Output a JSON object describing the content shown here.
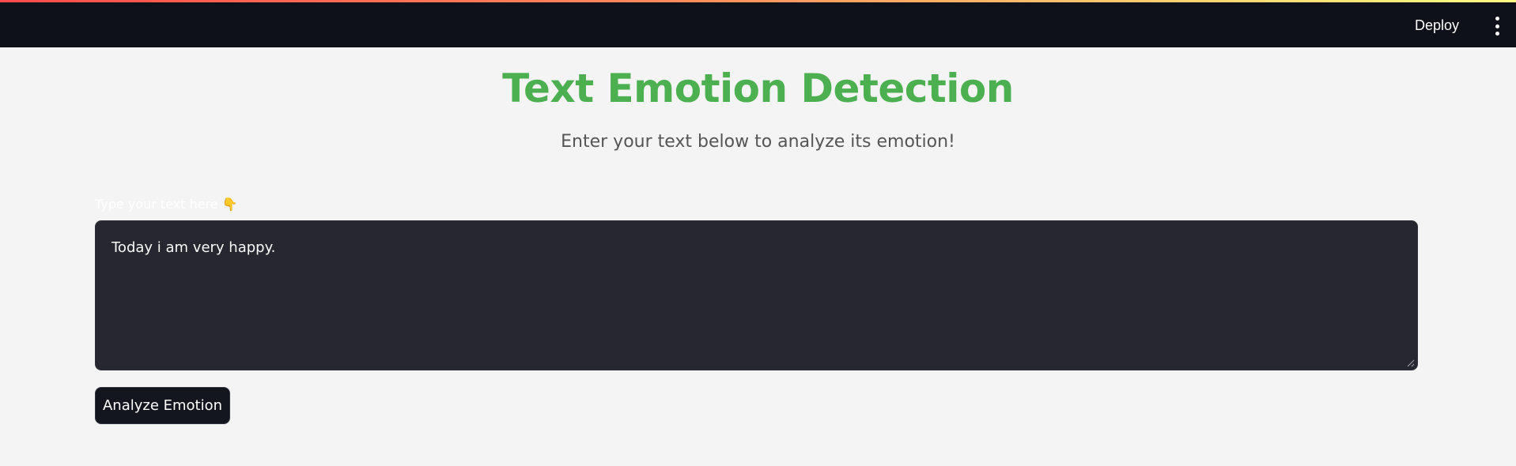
{
  "header": {
    "deploy_label": "Deploy",
    "menu_icon": "more-vertical-icon"
  },
  "main": {
    "title": "Text Emotion Detection",
    "subtitle": "Enter your text below to analyze its emotion!",
    "input": {
      "label": "Type your text here",
      "label_emoji": "👇",
      "value": "Today i am very happy."
    },
    "analyze_button_label": "Analyze Emotion"
  },
  "colors": {
    "title_green": "#4caf50",
    "header_bg": "#0e111a",
    "textarea_bg": "#262730",
    "button_bg": "#13161f",
    "page_bg": "#f4f4f5"
  }
}
